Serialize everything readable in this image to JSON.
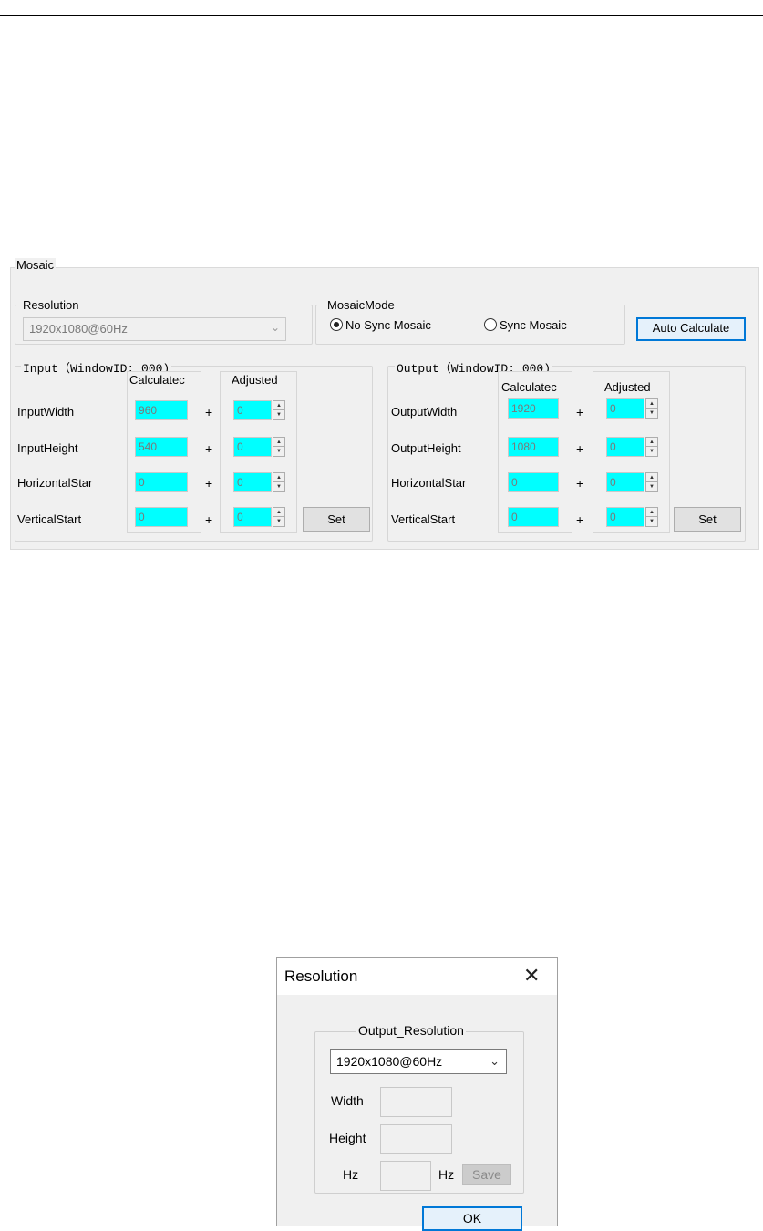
{
  "mosaic": {
    "title": "Mosaic",
    "resolution": {
      "label": "Resolution",
      "value": "1920x1080@60Hz"
    },
    "mode": {
      "label": "MosaicMode",
      "options": [
        "No Sync Mosaic",
        "Sync Mosaic"
      ],
      "selected": "No Sync Mosaic"
    },
    "auto_calculate_label": "Auto Calculate",
    "input": {
      "title": "Input（WindowID: 000)",
      "calculated_header": "Calculatec",
      "adjusted_header": "Adjusted",
      "rows": [
        {
          "label": "InputWidth",
          "calculated": "960",
          "adjusted": "0"
        },
        {
          "label": "InputHeight",
          "calculated": "540",
          "adjusted": "0"
        },
        {
          "label": "HorizontalStar",
          "calculated": "0",
          "adjusted": "0"
        },
        {
          "label": "VerticalStart",
          "calculated": "0",
          "adjusted": "0"
        }
      ],
      "set_label": "Set"
    },
    "output": {
      "title": "Output（WindowID: 000)",
      "calculated_header": "Calculatec",
      "adjusted_header": "Adjusted",
      "rows": [
        {
          "label": "OutputWidth",
          "calculated": "1920",
          "adjusted": "0"
        },
        {
          "label": "OutputHeight",
          "calculated": "1080",
          "adjusted": "0"
        },
        {
          "label": "HorizontalStar",
          "calculated": "0",
          "adjusted": "0"
        },
        {
          "label": "VerticalStart",
          "calculated": "0",
          "adjusted": "0"
        }
      ],
      "set_label": "Set"
    },
    "plus_sign": "+",
    "field_color": "#00ffff"
  },
  "dialog": {
    "title": "Resolution",
    "close_glyph": "✕",
    "group_label": "Output_Resolution",
    "resolution_value": "1920x1080@60Hz",
    "width_label": "Width",
    "height_label": "Height",
    "hz_label": "Hz",
    "hz_unit": "Hz",
    "save_label": "Save",
    "ok_label": "OK"
  },
  "accent_color": "#0078d7"
}
